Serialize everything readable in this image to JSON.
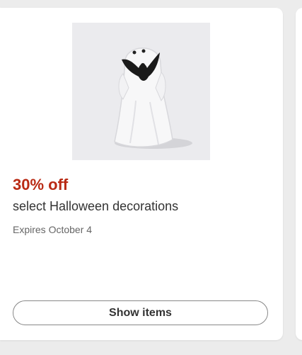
{
  "offer": {
    "image_alt": "White ghost figurine holding a black bat",
    "discount": "30% off",
    "title": "select Halloween decorations",
    "expires": "Expires October 4",
    "button_label": "Show items"
  },
  "colors": {
    "discount": "#b92a14",
    "background": "#ececec",
    "card": "#ffffff"
  }
}
